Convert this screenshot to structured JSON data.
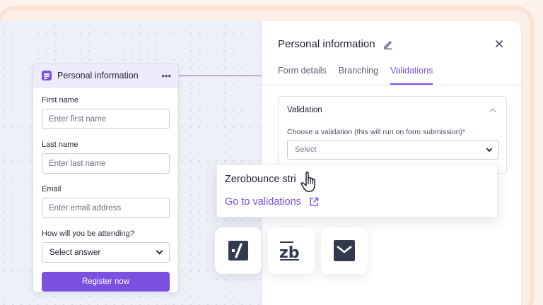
{
  "form_node": {
    "title": "Personal information",
    "menu_glyph": "•••",
    "fields": [
      {
        "label": "First name",
        "placeholder": "Enter first name"
      },
      {
        "label": "Last name",
        "placeholder": "Enter last name"
      },
      {
        "label": "Email",
        "placeholder": "Enter email address"
      }
    ],
    "attending": {
      "label": "How will you be attending?",
      "value": "Select answer"
    },
    "submit_label": "Register now"
  },
  "panel": {
    "title": "Personal information",
    "tabs": [
      {
        "label": "Form details",
        "active": false
      },
      {
        "label": "Branching",
        "active": false
      },
      {
        "label": "Validations",
        "active": true
      }
    ],
    "validation": {
      "title": "Validation",
      "select_label": "Choose a validation (this will run on form submission)",
      "required_mark": "*",
      "select_placeholder": "Select"
    }
  },
  "dropdown": {
    "option_text": "Zerobounce stri",
    "link_label": "Go to validations"
  },
  "integrations": [
    {
      "name": "checkmark-logo-icon"
    },
    {
      "name": "zb-logo-icon",
      "text": "zb"
    },
    {
      "name": "mail-logo-icon"
    }
  ],
  "colors": {
    "accent": "#7b4fe0",
    "accent_soft": "#efeafc",
    "required": "#e0334c",
    "logo_dark": "#323a4d"
  }
}
